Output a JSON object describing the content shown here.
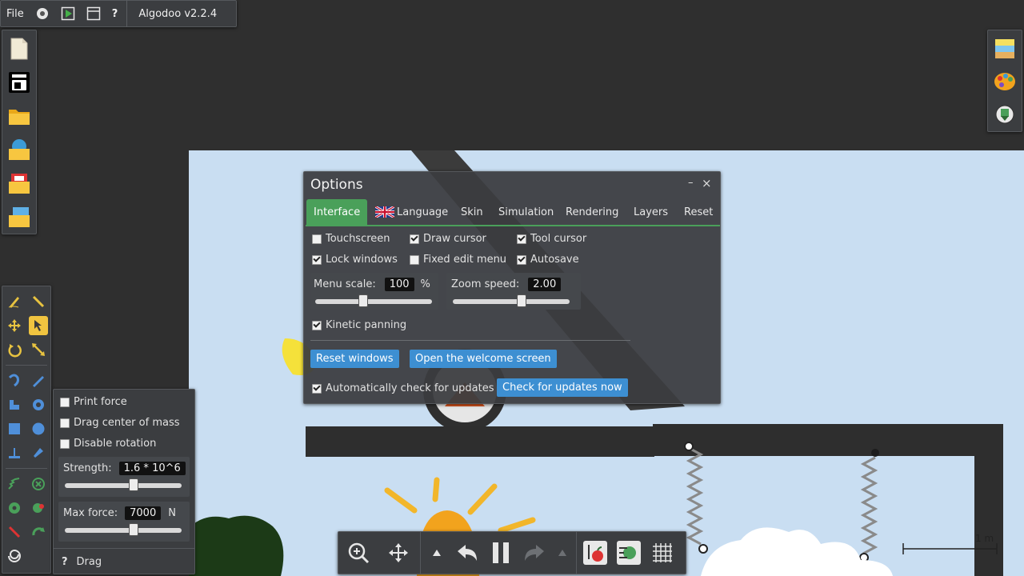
{
  "topbar": {
    "file_label": "File",
    "settings_icon": "gear-icon",
    "play_icon": "play-window-icon",
    "window_icon": "window-icon",
    "help_label": "?",
    "app_title": "Algodoo v2.2.4"
  },
  "left_file_toolbar": {
    "icons": [
      "new-scene-icon",
      "save-icon",
      "open-folder-icon",
      "open-online-icon",
      "open-recent-icon",
      "open-images-icon"
    ]
  },
  "right_toolbar": {
    "icons": [
      "background-icon",
      "palette-icon",
      "export-icon"
    ]
  },
  "options": {
    "title": "Options",
    "minimize_label": "–",
    "close_label": "×",
    "tabs": [
      {
        "label": "Interface",
        "active": true
      },
      {
        "label": "Language",
        "active": false
      },
      {
        "label": "Skin",
        "active": false
      },
      {
        "label": "Simulation",
        "active": false
      },
      {
        "label": "Rendering",
        "active": false
      },
      {
        "label": "Layers",
        "active": false
      },
      {
        "label": "Reset",
        "active": false
      }
    ],
    "checkboxes": [
      {
        "label": "Touchscreen",
        "checked": false
      },
      {
        "label": "Draw cursor",
        "checked": true
      },
      {
        "label": "Tool cursor",
        "checked": true
      },
      {
        "label": "Lock windows",
        "checked": true
      },
      {
        "label": "Fixed edit menu",
        "checked": false
      },
      {
        "label": "Autosave",
        "checked": true
      }
    ],
    "menu_scale": {
      "label": "Menu scale:",
      "value": "100",
      "unit": "%",
      "slider_level": 0.4
    },
    "zoom_speed": {
      "label": "Zoom speed:",
      "value": "2.00",
      "slider_level": 0.6
    },
    "kinetic_panning": {
      "label": "Kinetic panning",
      "checked": true
    },
    "reset_windows_label": "Reset windows",
    "welcome_label": "Open the welcome screen",
    "auto_update": {
      "label": "Automatically check for updates",
      "checked": true
    },
    "check_updates_label": "Check for updates now"
  },
  "drag_panel": {
    "print_force": {
      "label": "Print force",
      "checked": false
    },
    "drag_center": {
      "label": "Drag center of mass",
      "checked": false
    },
    "disable_rotation": {
      "label": "Disable rotation",
      "checked": false
    },
    "strength": {
      "label": "Strength:",
      "value": "1.6 * 10^6",
      "slider_level": 0.6
    },
    "max_force": {
      "label": "Max force:",
      "value": "7000",
      "unit": "N",
      "slider_level": 0.6
    },
    "help_label": "?",
    "tool_name": "Drag"
  },
  "scale_bar": {
    "label": "1 m"
  },
  "colors": {
    "accent_green": "#4aa05a",
    "button_blue": "#3d8fd2",
    "sky": "#c9def2",
    "panel": "#3b3d40"
  }
}
